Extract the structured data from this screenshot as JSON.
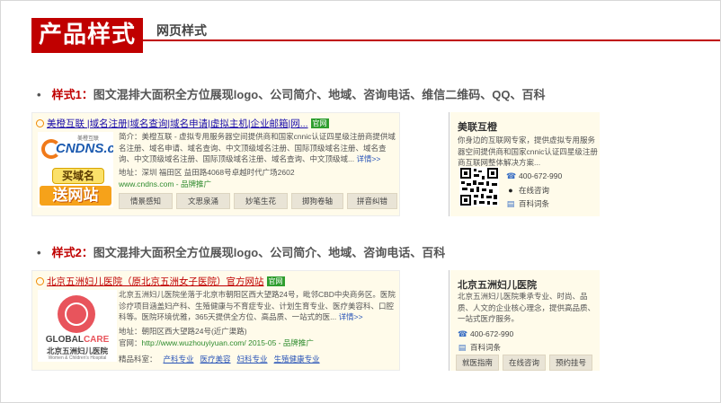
{
  "header": {
    "badge": "产品样式",
    "subtitle": "网页样式"
  },
  "style1": {
    "bullet": "•",
    "label": "样式1：",
    "heading": "图文混排大面积全方位展现logo、公司简介、地域、咨询电话、维信二维码、QQ、百科",
    "ad": {
      "title": "美橙互联 |域名注册|域名查询|域名申请|虚拟主机|企业邮箱|网...",
      "badge": "官网",
      "logo": {
        "mini": "美橙互联",
        "brand": "CNDNS.com",
        "buy": "买域名",
        "gift": "送网站"
      },
      "desc_prefix": "简介：",
      "desc": "美橙互联 - 虚拟专用服务器空间提供商和国家cnnic认证四星级注册商提供域名注册、域名申请、域名查询、中文顶级域名注册、国际顶级域名注册、域名查询、中文顶级域名注册、国际顶级域名注册、域名查询、中文顶级域...",
      "more": "详情>>",
      "address": "地址：深圳 福田区 益田路4068号卓越时代广场2602",
      "url": "www.cndns.com - 品牌推广",
      "buttons": [
        "情景感知",
        "文思泉涌",
        "妙笔生花",
        "掷狗卷轴",
        "拼音纠错"
      ]
    },
    "side": {
      "title": "美联互橙",
      "desc": "你身边的互联网专家，提供虚拟专用服务器空间提供商和国家cnnic认证四星级注册商互联网整体解决方案...",
      "phone": "400-672-990",
      "consult": "在线咨询",
      "wiki": "百科词条"
    }
  },
  "style2": {
    "bullet": "•",
    "label": "样式2：",
    "heading": "图文混排大面积全方位展现logo、公司简介、地域、咨询电话、百科",
    "ad": {
      "title": "北京五洲妇儿医院（原北京五洲女子医院）官方网站",
      "badge": "官网",
      "logo": {
        "brand_a": "GLOBAL",
        "brand_b": "CARE",
        "cn": "北京五洲妇儿医院",
        "en": "Women & Children's Hospital"
      },
      "desc": "北京五洲妇儿医院坐落于北京市朝阳区西大望路24号，毗邻CBD中央商务区。医院诊疗项目涵盖妇产科、生殖健康与不育症专业、计划生育专业、医疗美容科、口腔科等。医院环境优雅，365天提供全方位、高品质、一站式的医...",
      "more": "详情>>",
      "address": "地址：朝阳区西大望路24号(近广渠路)",
      "url_prefix": "官网：",
      "url": "http://www.wuzhouyiyuan.com/ 2015-05 - 品牌推广",
      "dept_label": "精品科室：",
      "depts": [
        "产科专业",
        "医疗美容",
        "妇科专业",
        "生殖健康专业"
      ]
    },
    "side": {
      "title": "北京五洲妇儿医院",
      "desc": "北京五洲妇儿医院秉承专业、时尚、品质、人文的企业核心理念，提供高品质、一站式医疗服务。",
      "phone": "400-672-990",
      "wiki": "百科词条",
      "buttons": [
        "就医指南",
        "在线咨询",
        "预约挂号"
      ]
    }
  },
  "colors": {
    "accent": "#c00000",
    "ad_bg": "#fffbea",
    "link": "#1a0dab",
    "green": "#2e8b2e"
  }
}
